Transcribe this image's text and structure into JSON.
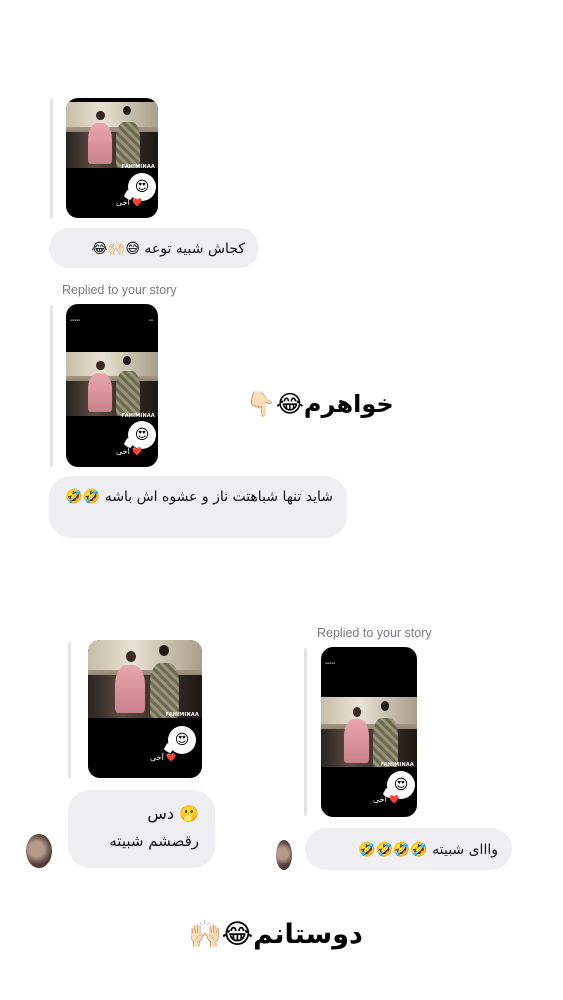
{
  "story_replies": [
    {
      "caption": "آخی",
      "heart": "❤️",
      "emoji": "😍",
      "watermark": "FAHIMINAA"
    },
    {
      "replied_label": "Replied to your story",
      "caption": "آخی",
      "heart": "❤️",
      "emoji": "😍",
      "watermark": "FAHIMINAA"
    },
    {
      "caption": "آخی",
      "heart": "❤️",
      "emoji": "😍",
      "watermark": "FAHIMINAA"
    },
    {
      "replied_label": "Replied to your story",
      "caption": "آخی",
      "heart": "❤️",
      "emoji": "😍",
      "watermark": "FAHIMINAA"
    }
  ],
  "messages": [
    {
      "text": "کجاش شبیه توعه 😅🙌🏻😂"
    },
    {
      "text": "شاید تنها شباهتت ناز و عشوه اش باشه 🤣🤣"
    },
    {
      "line1": "🫢 دس",
      "line2": "رقصشم شبیته"
    },
    {
      "text": "وااای شبیته 🤣🤣🤣🤣"
    }
  ],
  "overlay_captions": {
    "middle": "خواهرم😂👇🏻",
    "bottom": "دوستانم😂🙌🏻"
  },
  "colors": {
    "bubble_bg": "#efeff2",
    "replied_text": "#7b7b80",
    "story_bg": "#000000",
    "heart": "#e0243a"
  }
}
